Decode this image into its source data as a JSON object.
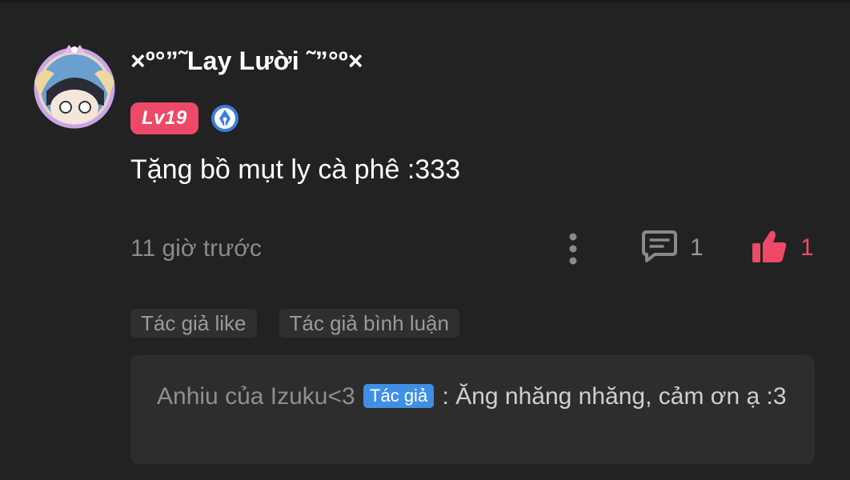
{
  "comment": {
    "username": "×º°”˜Lay Lười ˜”°º×",
    "level_badge": "Lv19",
    "text": "Tặng bồ mụt ly cà phê :333",
    "time": "11 giờ trước",
    "reply_count": "1",
    "like_count": "1",
    "tags": [
      "Tác giả like",
      "Tác giả bình luận"
    ]
  },
  "reply": {
    "author": "Anhiu của Izuku<3",
    "author_tag": "Tác giả",
    "separator": " : ",
    "text": "Ăng nhăng nhăng, cảm ơn ạ :3"
  },
  "colors": {
    "background": "#222222",
    "accent_pink": "#ee4968",
    "author_tag_blue": "#3f8fe6",
    "muted_text": "#8a8a8a"
  },
  "icons": {
    "more": "more-vertical-icon",
    "reply": "comment-icon",
    "like": "thumbs-up-icon",
    "badge": "pen-nib-icon"
  }
}
